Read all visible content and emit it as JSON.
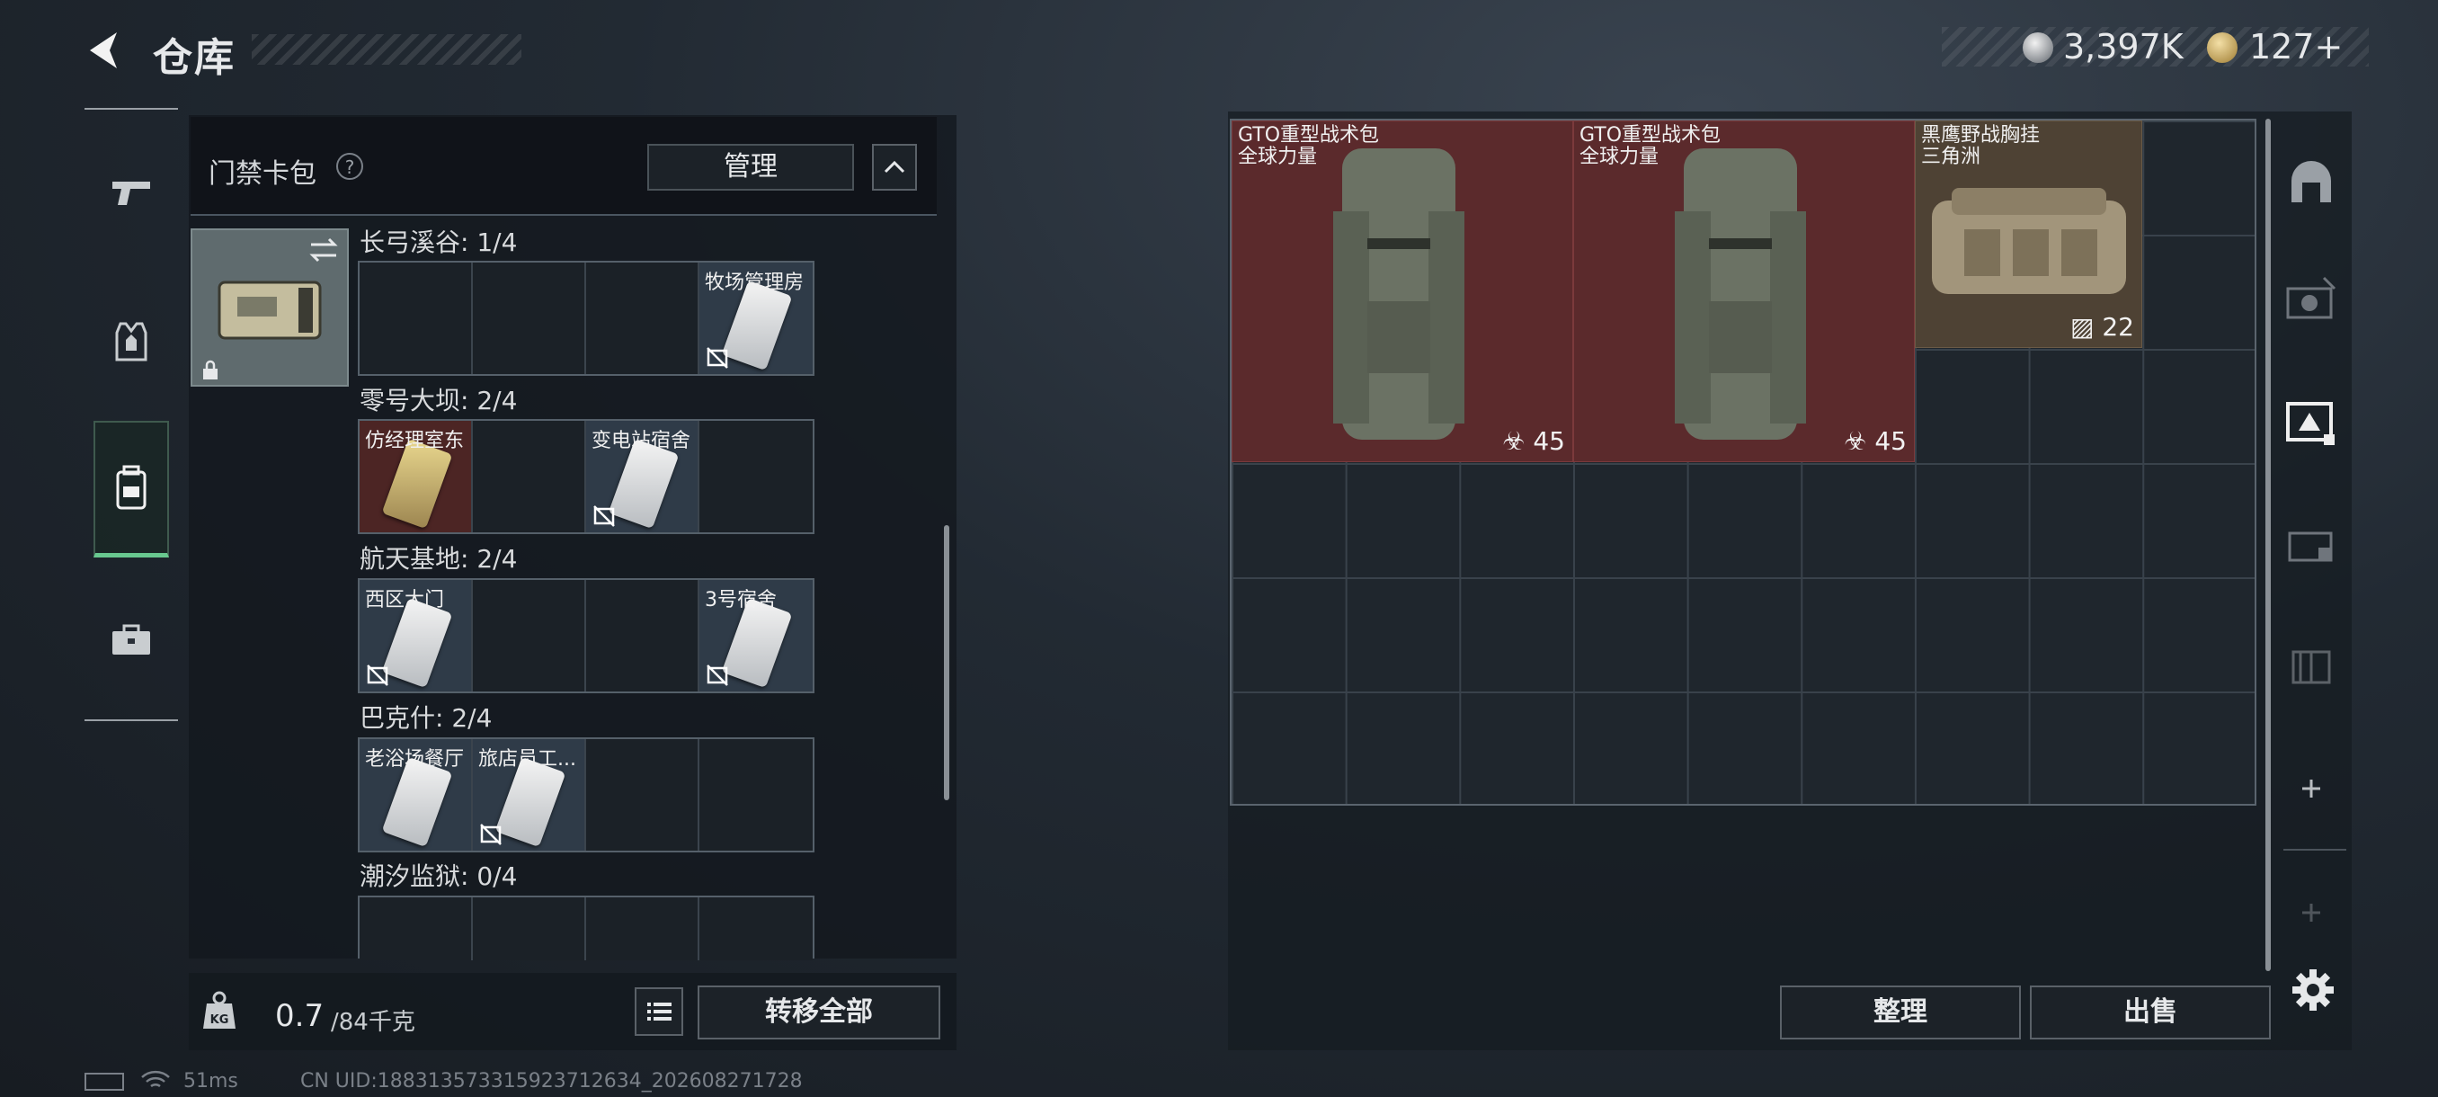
{
  "header": {
    "title": "仓库",
    "currency1": "3,397K",
    "currency2": "127+"
  },
  "card_pack": {
    "title": "门禁卡包",
    "help": "?",
    "manage_label": "管理"
  },
  "maps": [
    {
      "title": "长弓溪谷: 1/4",
      "slots": [
        {
          "label": ""
        },
        {
          "label": ""
        },
        {
          "label": ""
        },
        {
          "label": "牧场管理房"
        }
      ]
    },
    {
      "title": "零号大坝: 2/4",
      "slots": [
        {
          "label": "仿经理室东"
        },
        {
          "label": ""
        },
        {
          "label": "变电站宿舍"
        },
        {
          "label": ""
        }
      ]
    },
    {
      "title": "航天基地: 2/4",
      "slots": [
        {
          "label": "西区大门"
        },
        {
          "label": ""
        },
        {
          "label": ""
        },
        {
          "label": "3号宿舍"
        }
      ]
    },
    {
      "title": "巴克什: 2/4",
      "slots": [
        {
          "label": "老浴场餐厅"
        },
        {
          "label": "旅店员工..."
        },
        {
          "label": ""
        },
        {
          "label": ""
        }
      ]
    },
    {
      "title": "潮汐监狱: 0/4",
      "slots": [
        {
          "label": ""
        },
        {
          "label": ""
        },
        {
          "label": ""
        },
        {
          "label": ""
        }
      ]
    }
  ],
  "footer_left": {
    "weight": "0.7",
    "weight_capacity": "/84千克",
    "transfer_label": "转移全部"
  },
  "stash": {
    "items": [
      {
        "name": "GTO重型战术包",
        "sub": "全球力量",
        "capacity": "45"
      },
      {
        "name": "GTO重型战术包",
        "sub": "全球力量",
        "capacity": "45"
      },
      {
        "name": "黑鹰野战胸挂",
        "sub": "三角洲",
        "capacity": "22"
      }
    ],
    "sort_label": "整理",
    "sell_label": "出售"
  },
  "status": {
    "ping": "51ms",
    "uid": "CN UID:188313573315923712634_202608271728"
  },
  "colors": {
    "accent_green": "#68c88f",
    "item_red": "#5b2a2c",
    "item_tan": "#4e4234"
  }
}
